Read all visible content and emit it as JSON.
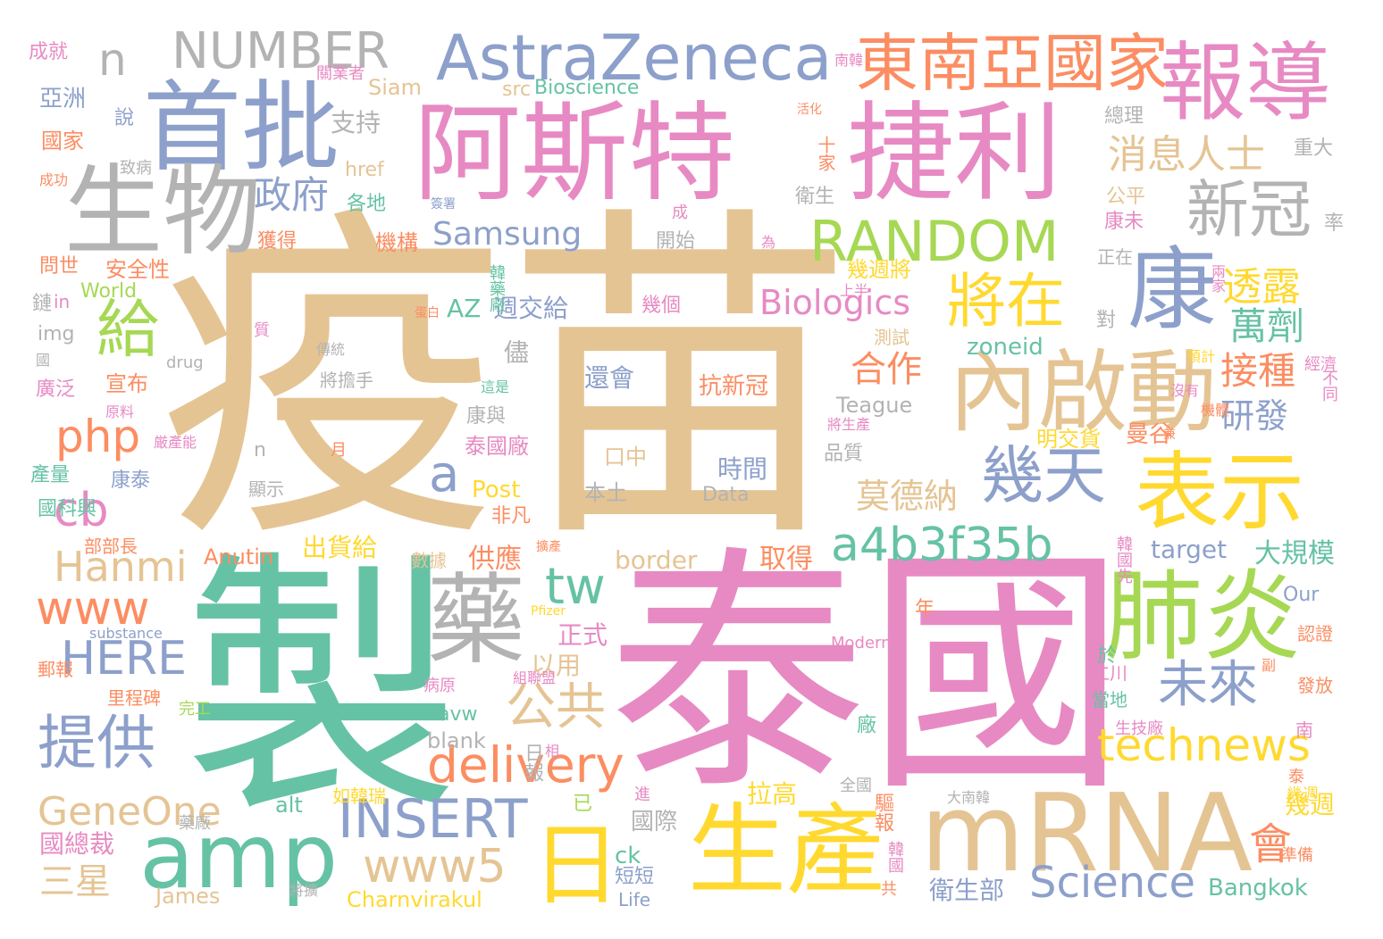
{
  "palette": {
    "tan": "#e5c494",
    "pink": "#e78ac3",
    "green": "#66c2a5",
    "blue": "#8da0cb",
    "orange": "#fc8d62",
    "lime": "#a6d854",
    "yellow": "#ffd92f",
    "gray": "#b3b3b3"
  },
  "words": [
    {
      "text": "疫苗",
      "color": "tan"
    },
    {
      "text": "製",
      "color": "green"
    },
    {
      "text": "泰國",
      "color": "pink"
    },
    {
      "text": "阿斯特",
      "color": "pink"
    },
    {
      "text": "捷利",
      "color": "pink"
    },
    {
      "text": "首批",
      "color": "blue"
    },
    {
      "text": "生物",
      "color": "gray"
    },
    {
      "text": "AstraZeneca",
      "color": "blue"
    },
    {
      "text": "NUMBER",
      "color": "gray"
    },
    {
      "text": "n",
      "color": "gray"
    },
    {
      "text": "東南亞國家",
      "color": "orange"
    },
    {
      "text": "報導",
      "color": "pink"
    },
    {
      "text": "康",
      "color": "blue"
    },
    {
      "text": "內啟動",
      "color": "tan"
    },
    {
      "text": "表示",
      "color": "yellow"
    },
    {
      "text": "mRNA",
      "color": "tan"
    },
    {
      "text": "生產",
      "color": "yellow"
    },
    {
      "text": "日",
      "color": "yellow"
    },
    {
      "text": "藥",
      "color": "gray"
    },
    {
      "text": "amp",
      "color": "green"
    },
    {
      "text": "肺炎",
      "color": "lime"
    },
    {
      "text": "新冠",
      "color": "gray"
    },
    {
      "text": "將在",
      "color": "yellow"
    },
    {
      "text": "幾天",
      "color": "blue"
    },
    {
      "text": "RANDOM",
      "color": "lime"
    },
    {
      "text": "a4b3f35b",
      "color": "green"
    },
    {
      "text": "給",
      "color": "lime"
    },
    {
      "text": "政府",
      "color": "blue"
    },
    {
      "text": "php",
      "color": "orange"
    },
    {
      "text": "technews",
      "color": "yellow"
    },
    {
      "text": "公共",
      "color": "tan"
    },
    {
      "text": "delivery",
      "color": "orange"
    },
    {
      "text": "提供",
      "color": "blue"
    },
    {
      "text": "HERE",
      "color": "blue"
    },
    {
      "text": "www",
      "color": "orange"
    },
    {
      "text": "Hanmi",
      "color": "tan"
    },
    {
      "text": "INSERT",
      "color": "blue"
    },
    {
      "text": "www5",
      "color": "tan"
    },
    {
      "text": "Science",
      "color": "blue"
    },
    {
      "text": "未來",
      "color": "blue"
    },
    {
      "text": "GeneOne",
      "color": "tan"
    },
    {
      "text": "Samsung",
      "color": "blue"
    },
    {
      "text": "Biologics",
      "color": "pink"
    },
    {
      "text": "消息人士",
      "color": "tan"
    },
    {
      "text": "透露",
      "color": "yellow"
    },
    {
      "text": "萬劑",
      "color": "green"
    },
    {
      "text": "接種",
      "color": "orange"
    },
    {
      "text": "研發",
      "color": "blue"
    },
    {
      "text": "合作",
      "color": "orange"
    },
    {
      "text": "莫德納",
      "color": "tan"
    },
    {
      "text": "tw",
      "color": "green"
    },
    {
      "text": "cb",
      "color": "pink"
    },
    {
      "text": "a",
      "color": "blue"
    },
    {
      "text": "會",
      "color": "orange"
    },
    {
      "text": "三星",
      "color": "tan"
    },
    {
      "text": "AZ",
      "color": "green"
    },
    {
      "text": "週交給",
      "color": "blue"
    },
    {
      "text": "出貨給",
      "color": "yellow"
    },
    {
      "text": "供應",
      "color": "orange"
    },
    {
      "text": "取得",
      "color": "orange"
    },
    {
      "text": "大規模",
      "color": "green"
    },
    {
      "text": "border",
      "color": "tan"
    },
    {
      "text": "target",
      "color": "blue"
    },
    {
      "text": "衛生部",
      "color": "blue"
    },
    {
      "text": "Bangkok",
      "color": "green"
    },
    {
      "text": "Charnvirakul",
      "color": "yellow"
    },
    {
      "text": "James",
      "color": "tan"
    },
    {
      "text": "國總裁",
      "color": "pink"
    },
    {
      "text": "alt",
      "color": "green"
    },
    {
      "text": "Anutin",
      "color": "orange"
    },
    {
      "text": "blank",
      "color": "gray"
    },
    {
      "text": "avw",
      "color": "green"
    },
    {
      "text": "正式",
      "color": "pink"
    },
    {
      "text": "以用",
      "color": "tan"
    },
    {
      "text": "拉高",
      "color": "yellow"
    },
    {
      "text": "國際",
      "color": "gray"
    },
    {
      "text": "幾週",
      "color": "yellow"
    },
    {
      "text": "Post",
      "color": "yellow"
    },
    {
      "text": "非凡",
      "color": "orange"
    },
    {
      "text": "康泰",
      "color": "blue"
    },
    {
      "text": "泰國廠",
      "color": "pink"
    },
    {
      "text": "明交貨",
      "color": "yellow"
    },
    {
      "text": "曼谷",
      "color": "orange"
    },
    {
      "text": "時間",
      "color": "blue"
    },
    {
      "text": "本土",
      "color": "gray"
    },
    {
      "text": "還會",
      "color": "blue"
    },
    {
      "text": "抗新冠",
      "color": "orange"
    },
    {
      "text": "口中",
      "color": "tan"
    },
    {
      "text": "Data",
      "color": "gray"
    },
    {
      "text": "Teague",
      "color": "gray"
    },
    {
      "text": "品質",
      "color": "gray"
    },
    {
      "text": "康與",
      "color": "gray"
    },
    {
      "text": "zoneid",
      "color": "green"
    },
    {
      "text": "img",
      "color": "gray"
    },
    {
      "text": "儘",
      "color": "gray"
    },
    {
      "text": "宣布",
      "color": "orange"
    },
    {
      "text": "廣泛",
      "color": "pink"
    },
    {
      "text": "World",
      "color": "lime"
    },
    {
      "text": "安全性",
      "color": "orange"
    },
    {
      "text": "問世",
      "color": "orange"
    },
    {
      "text": "機構",
      "color": "orange"
    },
    {
      "text": "開始",
      "color": "gray"
    },
    {
      "text": "獲得",
      "color": "orange"
    },
    {
      "text": "幾週將",
      "color": "yellow"
    },
    {
      "text": "康未",
      "color": "pink"
    },
    {
      "text": "公平",
      "color": "tan"
    },
    {
      "text": "衛生",
      "color": "gray"
    },
    {
      "text": "支持",
      "color": "gray"
    },
    {
      "text": "href",
      "color": "tan"
    },
    {
      "text": "Siam",
      "color": "tan"
    },
    {
      "text": "src",
      "color": "tan"
    },
    {
      "text": "Bioscience",
      "color": "green"
    },
    {
      "text": "亞洲",
      "color": "blue"
    },
    {
      "text": "國家",
      "color": "orange"
    },
    {
      "text": "成就",
      "color": "pink"
    },
    {
      "text": "總理",
      "color": "gray"
    },
    {
      "text": "重大",
      "color": "gray"
    },
    {
      "text": "率",
      "color": "gray"
    },
    {
      "text": "各地",
      "color": "green"
    },
    {
      "text": "正在",
      "color": "gray"
    },
    {
      "text": "對",
      "color": "gray"
    },
    {
      "text": "幾個",
      "color": "pink"
    },
    {
      "text": "測試",
      "color": "tan"
    },
    {
      "text": "in",
      "color": "pink"
    },
    {
      "text": "drug",
      "color": "gray"
    },
    {
      "text": "產量",
      "color": "green"
    },
    {
      "text": "顯示",
      "color": "gray"
    },
    {
      "text": "部部長",
      "color": "orange"
    },
    {
      "text": "郵報",
      "color": "orange"
    },
    {
      "text": "里程碑",
      "color": "orange"
    },
    {
      "text": "數據",
      "color": "tan"
    },
    {
      "text": "於",
      "color": "green"
    },
    {
      "text": "當地",
      "color": "green"
    },
    {
      "text": "廠",
      "color": "green"
    },
    {
      "text": "認證",
      "color": "orange"
    },
    {
      "text": "發放",
      "color": "orange"
    },
    {
      "text": "Our",
      "color": "blue"
    },
    {
      "text": "substance",
      "color": "blue"
    },
    {
      "text": "ck",
      "color": "green"
    },
    {
      "text": "短短",
      "color": "blue"
    },
    {
      "text": "Life",
      "color": "blue"
    },
    {
      "text": "幾週",
      "color": "yellow"
    },
    {
      "text": "驅報",
      "color": "orange"
    },
    {
      "text": "泰",
      "color": "orange"
    },
    {
      "text": "年",
      "color": "orange"
    },
    {
      "text": "國科興",
      "color": "green"
    },
    {
      "text": "n",
      "color": "gray"
    },
    {
      "text": "已",
      "color": "lime"
    },
    {
      "text": "進",
      "color": "pink"
    },
    {
      "text": "大南韓",
      "color": "gray"
    },
    {
      "text": "Pfizer",
      "color": "yellow"
    },
    {
      "text": "Moderna",
      "color": "pink"
    },
    {
      "text": "仁川",
      "color": "pink"
    },
    {
      "text": "生技廠",
      "color": "pink"
    },
    {
      "text": "南",
      "color": "pink"
    },
    {
      "text": "全國",
      "color": "gray"
    },
    {
      "text": "韓國",
      "color": "pink"
    },
    {
      "text": "共",
      "color": "orange"
    },
    {
      "text": "準備",
      "color": "orange"
    },
    {
      "text": "藥廠",
      "color": "gray"
    },
    {
      "text": "如韓瑞",
      "color": "yellow"
    },
    {
      "text": "將擴",
      "color": "gray"
    },
    {
      "text": "日報",
      "color": "gray"
    },
    {
      "text": "相",
      "color": "pink"
    },
    {
      "text": "組聯盟",
      "color": "pink"
    },
    {
      "text": "病原",
      "color": "pink"
    },
    {
      "text": "完工",
      "color": "lime"
    },
    {
      "text": "擴產",
      "color": "orange"
    },
    {
      "text": "韓國先",
      "color": "pink"
    },
    {
      "text": "副",
      "color": "orange"
    },
    {
      "text": "經濟",
      "color": "pink"
    },
    {
      "text": "預計",
      "color": "yellow"
    },
    {
      "text": "沒有",
      "color": "pink"
    },
    {
      "text": "機體",
      "color": "orange"
    },
    {
      "text": "不同",
      "color": "pink"
    },
    {
      "text": "兼",
      "color": "orange"
    },
    {
      "text": "將生產",
      "color": "pink"
    },
    {
      "text": "上半",
      "color": "pink"
    },
    {
      "text": "月",
      "color": "orange"
    },
    {
      "text": "蛋白",
      "color": "orange"
    },
    {
      "text": "質",
      "color": "pink"
    },
    {
      "text": "傳統",
      "color": "gray"
    },
    {
      "text": "將擔手",
      "color": "gray"
    },
    {
      "text": "這是",
      "color": "green"
    },
    {
      "text": "韓藥廠",
      "color": "green"
    },
    {
      "text": "為",
      "color": "pink"
    },
    {
      "text": "兩家",
      "color": "pink"
    },
    {
      "text": "成",
      "color": "pink"
    },
    {
      "text": "活化",
      "color": "orange"
    },
    {
      "text": "十家",
      "color": "orange"
    },
    {
      "text": "說",
      "color": "blue"
    },
    {
      "text": "鏈",
      "color": "gray"
    },
    {
      "text": "國",
      "color": "gray"
    },
    {
      "text": "原料",
      "color": "pink"
    },
    {
      "text": "厳產能",
      "color": "pink"
    },
    {
      "text": "致病",
      "color": "gray"
    },
    {
      "text": "成功",
      "color": "orange"
    },
    {
      "text": "簽署",
      "color": "blue"
    },
    {
      "text": "關業者",
      "color": "pink"
    },
    {
      "text": "南韓",
      "color": "pink"
    },
    {
      "text": "不",
      "color": "gray"
    }
  ]
}
